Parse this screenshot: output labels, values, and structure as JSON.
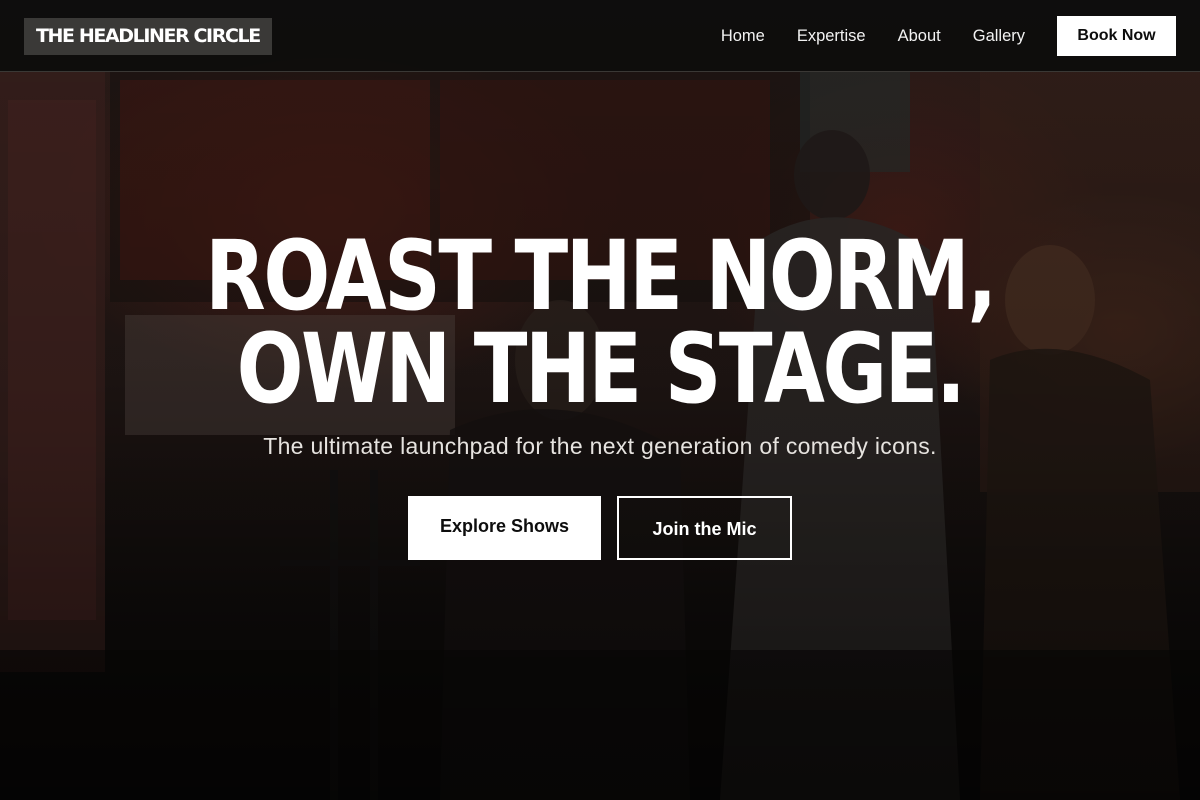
{
  "brand": {
    "logo_text": "THE HEADLINER CIRCLE"
  },
  "nav": {
    "links": [
      "Home",
      "Expertise",
      "About",
      "Gallery"
    ],
    "cta_label": "Book Now"
  },
  "hero": {
    "headline_line1": "ROAST THE NORM,",
    "headline_line2": "OWN THE STAGE.",
    "subtitle": "The ultimate launchpad for the next generation of comedy icons.",
    "primary_cta": "Explore Shows",
    "secondary_cta": "Join the Mic",
    "background_image": "comedy-club-entrance-photo"
  },
  "colors": {
    "nav_background": "#0e0d0c",
    "logo_background": "#3a3937",
    "button_fill": "#ffffff",
    "text_primary": "#ffffff"
  }
}
